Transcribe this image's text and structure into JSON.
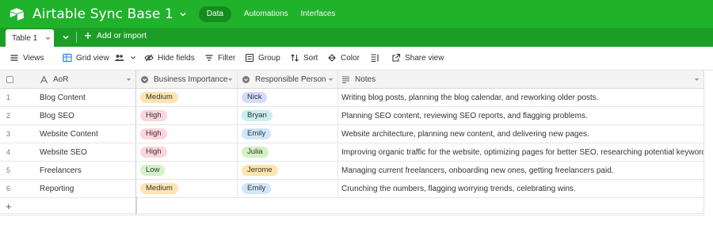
{
  "app": {
    "base_title": "Airtable Sync Base 1",
    "nav": {
      "active": "Data",
      "items": [
        "Automations",
        "Interfaces"
      ]
    }
  },
  "tabs": {
    "table_label": "Table 1",
    "add_import_label": "Add or import"
  },
  "toolbar": {
    "views_label": "Views",
    "grid_view_label": "Grid view",
    "hide_fields_label": "Hide fields",
    "filter_label": "Filter",
    "group_label": "Group",
    "sort_label": "Sort",
    "color_label": "Color",
    "share_view_label": "Share view"
  },
  "grid": {
    "columns": [
      "AoR",
      "Business Importance",
      "Responsible Person",
      "Notes"
    ],
    "rows": [
      {
        "num": "1",
        "aor": "Blog Content",
        "importance": "Medium",
        "person": "Nick",
        "notes": "Writing blog posts, planning the blog calendar, and reworking older posts."
      },
      {
        "num": "2",
        "aor": "Blog SEO",
        "importance": "High",
        "person": "Bryan",
        "notes": "Planning SEO content, reviewing SEO reports, and flagging problems."
      },
      {
        "num": "3",
        "aor": "Website Content",
        "importance": "High",
        "person": "Emily",
        "notes": "Website architecture, planning new content, and delivering new pages."
      },
      {
        "num": "4",
        "aor": "Website SEO",
        "importance": "High",
        "person": "Julia",
        "notes": "Improving organic traffic for the website, optimizing pages for better SEO, researching potential keywords."
      },
      {
        "num": "5",
        "aor": "Freelancers",
        "importance": "Low",
        "person": "Jerome",
        "notes": "Managing current freelancers, onboarding new ones, getting freelancers paid."
      },
      {
        "num": "6",
        "aor": "Reporting",
        "importance": "Medium",
        "person": "Emily",
        "notes": "Crunching the numbers, flagging worrying trends, celebrating wins."
      }
    ],
    "add_row_symbol": "+"
  },
  "colors": {
    "topbar": "#20b22b",
    "tabbar": "#1c9e26",
    "importance": {
      "Medium": "#ffe4b0",
      "High": "#fcd5dc",
      "Low": "#d4f2c8"
    },
    "person": {
      "Nick": "#d4dcfa",
      "Bryan": "#c9eef0",
      "Emily": "#d0e7fb",
      "Julia": "#d4f0c4",
      "Jerome": "#ffe4b0"
    }
  }
}
